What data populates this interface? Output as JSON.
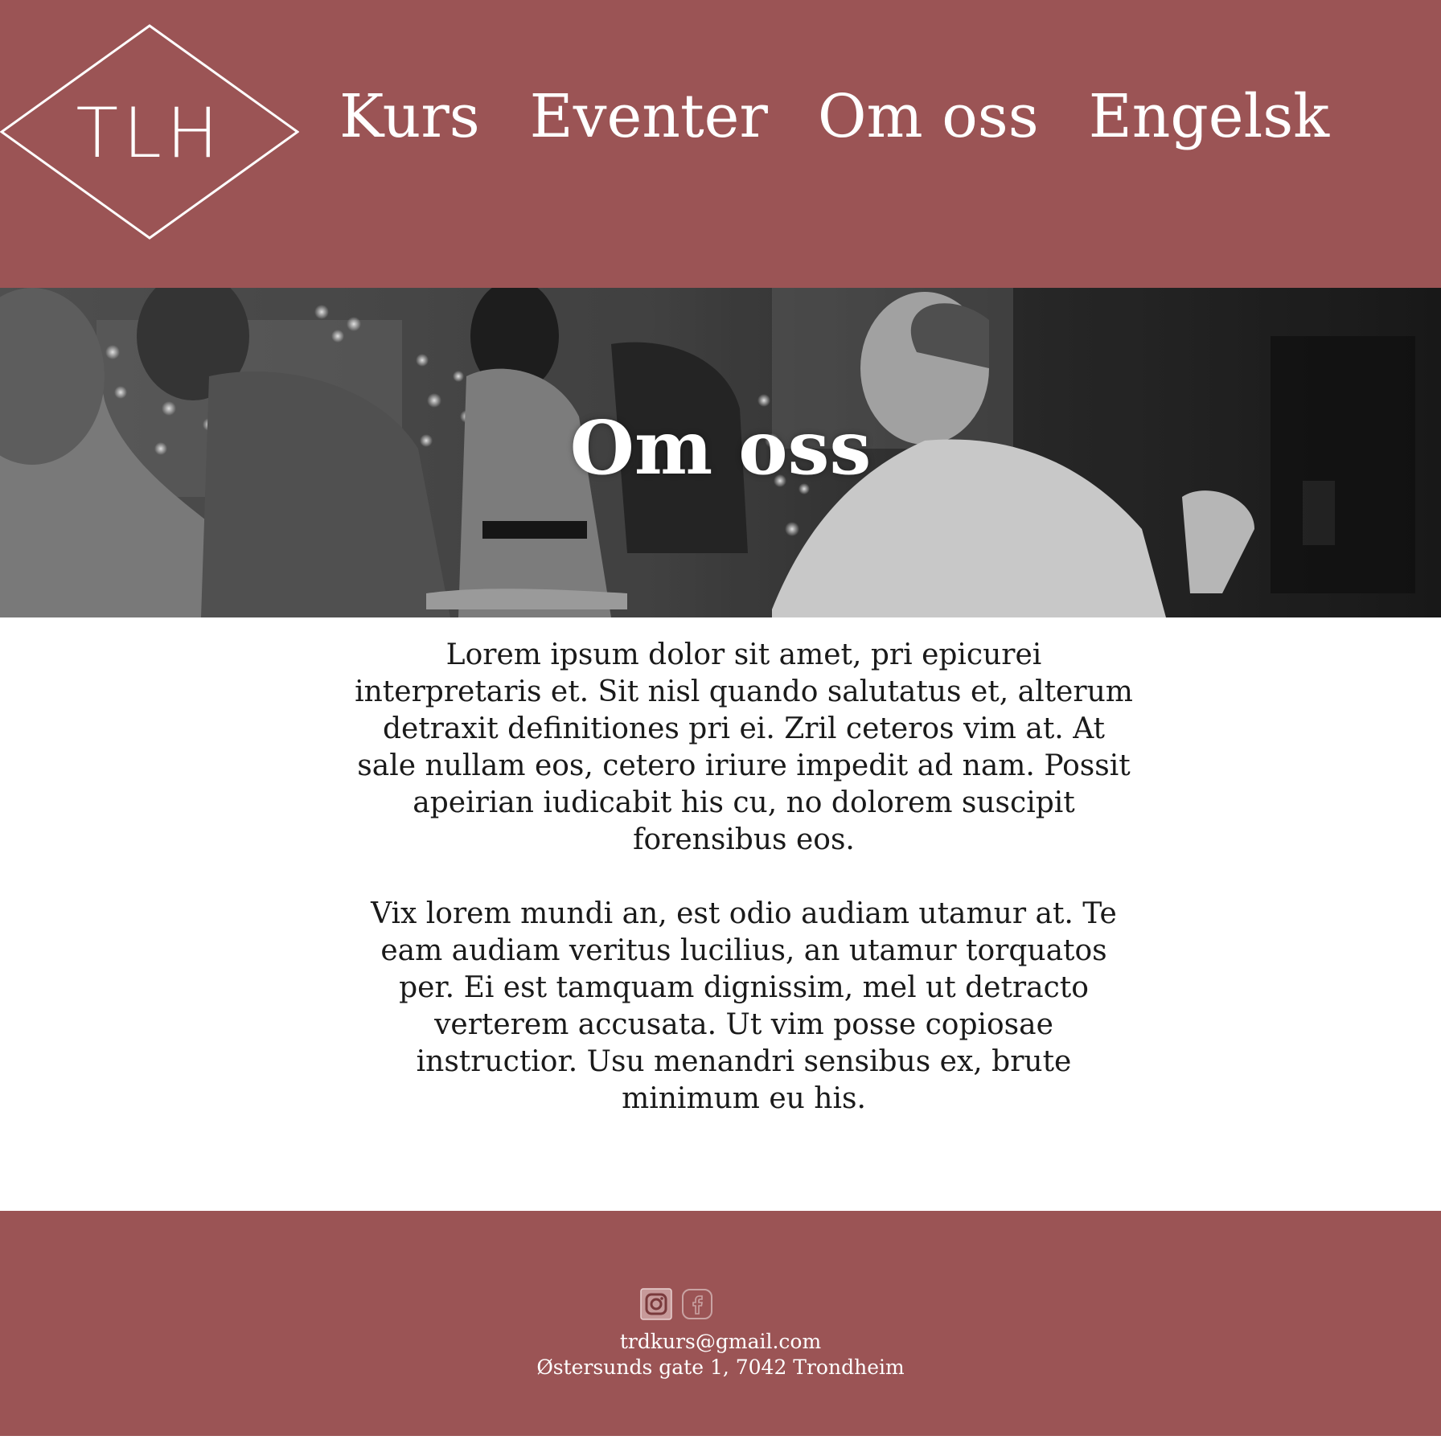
{
  "brand": {
    "logo_text": "TLH",
    "color": "#9b5455"
  },
  "nav": {
    "items": [
      {
        "label": "Kurs"
      },
      {
        "label": "Eventer"
      },
      {
        "label": "Om oss"
      },
      {
        "label": "Engelsk"
      }
    ]
  },
  "hero": {
    "title": "Om oss",
    "image": "dancing-couples-photo"
  },
  "content": {
    "paragraphs": [
      "Lorem ipsum dolor sit amet, pri epicurei interpretaris et. Sit nisl quando salutatus et, alterum detraxit definitiones pri ei. Zril ceteros vim at. At sale nullam eos, cetero iriure impedit ad nam. Possit apeirian iudicabit his cu, no dolorem suscipit forensibus eos.",
      "Vix lorem mundi an, est odio audiam utamur at. Te eam audiam veritus lucilius, an utamur torquatos per. Ei est tamquam dignissim, mel ut detracto verterem accusata. Ut vim posse copiosae instructior. Usu menandri sensibus ex, brute minimum eu his."
    ]
  },
  "footer": {
    "social": [
      {
        "icon": "instagram-icon"
      },
      {
        "icon": "facebook-icon"
      }
    ],
    "email": "trdkurs@gmail.com",
    "address": "Østersunds gate 1, 7042 Trondheim"
  }
}
